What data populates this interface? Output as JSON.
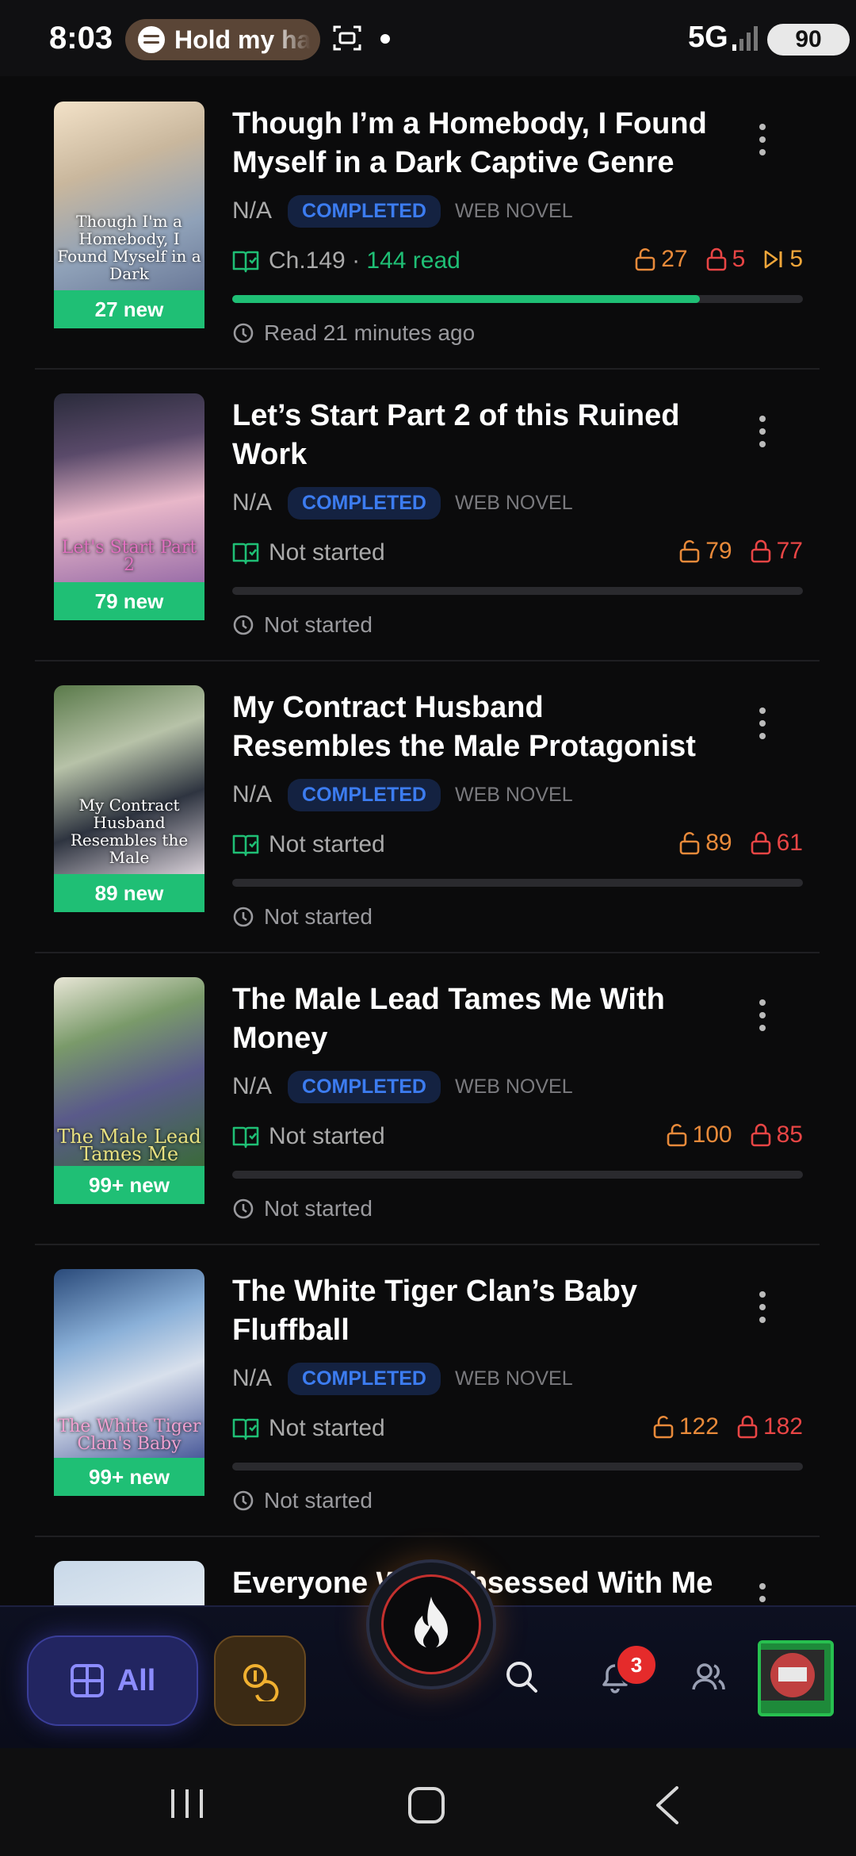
{
  "status_bar": {
    "time": "8:03",
    "media_text": "Hold my ha",
    "network": "5G",
    "battery": "90"
  },
  "items": [
    {
      "title": "Though I’m a Homebody, I Found Myself in a Dark Captive Genre",
      "cover_text": "Though I'm a Homebody, I Found Myself in a Dark",
      "new_badge": "27 new",
      "rating": "N/A",
      "status": "COMPLETED",
      "type": "WEB NOVEL",
      "chapter_label": "Ch.149",
      "read_label": "144 read",
      "count_unlocked": "27",
      "count_locked": "5",
      "count_skip": "5",
      "progress_fraction": 0.82,
      "last_read": "Read 21 minutes ago"
    },
    {
      "title": "Let’s Start Part 2 of this Ruined Work",
      "cover_text": "Let's Start Part 2",
      "new_badge": "79 new",
      "rating": "N/A",
      "status": "COMPLETED",
      "type": "WEB NOVEL",
      "chapter_label": "Not started",
      "count_unlocked": "79",
      "count_locked": "77",
      "progress_fraction": 0,
      "last_read": "Not started"
    },
    {
      "title": "My Contract Husband Resembles the Male Protagonist",
      "cover_text": "My Contract Husband Resembles the Male",
      "new_badge": "89 new",
      "rating": "N/A",
      "status": "COMPLETED",
      "type": "WEB NOVEL",
      "chapter_label": "Not started",
      "count_unlocked": "89",
      "count_locked": "61",
      "progress_fraction": 0,
      "last_read": "Not started"
    },
    {
      "title": "The Male Lead Tames Me With Money",
      "cover_text": "The Male Lead Tames Me",
      "new_badge": "99+ new",
      "rating": "N/A",
      "status": "COMPLETED",
      "type": "WEB NOVEL",
      "chapter_label": "Not started",
      "count_unlocked": "100",
      "count_locked": "85",
      "progress_fraction": 0,
      "last_read": "Not started"
    },
    {
      "title": "The White Tiger Clan’s Baby Fluffball",
      "cover_text": "The White Tiger Clan's Baby",
      "new_badge": "99+ new",
      "rating": "N/A",
      "status": "COMPLETED",
      "type": "WEB NOVEL",
      "chapter_label": "Not started",
      "count_unlocked": "122",
      "count_locked": "182",
      "progress_fraction": 0,
      "last_read": "Not started"
    },
    {
      "title": "Everyone Was Obsessed With Me"
    }
  ],
  "bottom_nav": {
    "all_label": "All",
    "notification_count": "3"
  },
  "colors": {
    "accent_green": "#1fbf75",
    "completed_blue": "#3c7cf0",
    "unlocked_orange": "#e88a3a",
    "locked_red": "#e84545"
  },
  "icons": [
    "spotify-icon",
    "scan-icon",
    "book-icon",
    "unlock-icon",
    "lock-icon",
    "skip-icon",
    "clock-icon",
    "more-icon",
    "grid-icon",
    "coins-icon",
    "flame-icon",
    "search-icon",
    "bell-icon",
    "people-icon",
    "recents-icon",
    "home-icon",
    "back-icon"
  ]
}
